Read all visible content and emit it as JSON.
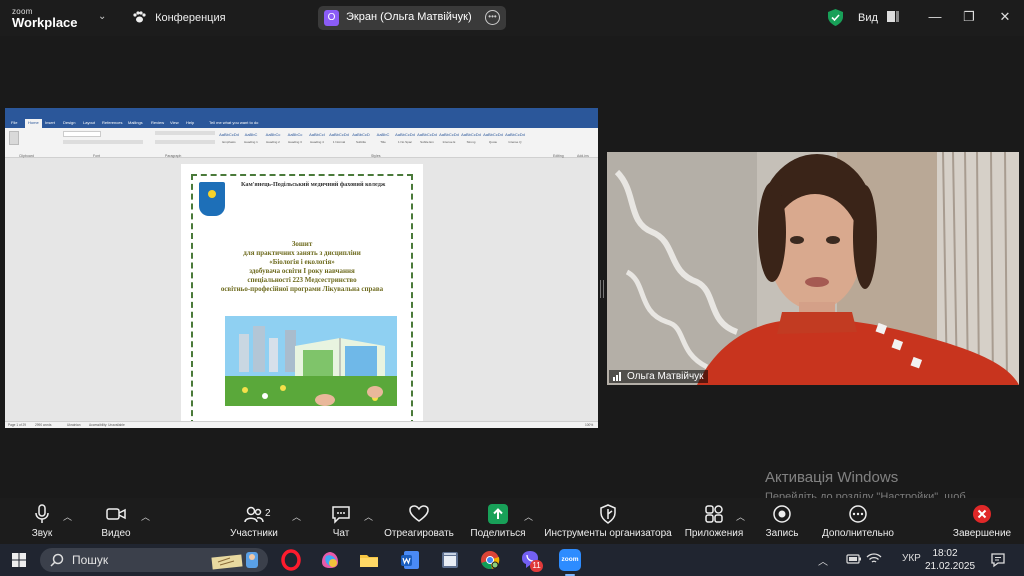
{
  "topbar": {
    "logo_small": "zoom",
    "logo_big": "Workplace",
    "conference_label": "Конференция",
    "share_initial": "О",
    "share_label": "Экран (Ольга Матвійчук)",
    "view_label": "Вид",
    "minimize_glyph": "—",
    "restore_glyph": "❐",
    "close_glyph": "✕"
  },
  "shared_screen": {
    "word_tabs": [
      "File",
      "Home",
      "Insert",
      "Design",
      "Layout",
      "References",
      "Mailings",
      "Review",
      "View",
      "Help",
      "Tell me what you want to do"
    ],
    "ribbon_groups": [
      "Clipboard",
      "Font",
      "Paragraph",
      "Styles",
      "Editing",
      "Add-ins"
    ],
    "styles": [
      {
        "sample": "AaBbCcDd",
        "label": "Emphasis"
      },
      {
        "sample": "AaBbC",
        "label": "Heading 1"
      },
      {
        "sample": "AaBbCc",
        "label": "Heading 2"
      },
      {
        "sample": "AaBbCc",
        "label": "Heading 3"
      },
      {
        "sample": "AaBbCcI",
        "label": "Heading 4"
      },
      {
        "sample": "AaBbCcDd",
        "label": "1 Normal"
      },
      {
        "sample": "AaBbCcD",
        "label": "Subtitle"
      },
      {
        "sample": "AaBbC",
        "label": "Title"
      },
      {
        "sample": "AaBbCcDd",
        "label": "1 No Spac"
      },
      {
        "sample": "AaBbCcDd",
        "label": "Subtle Em"
      },
      {
        "sample": "AaBbCcDd",
        "label": "Intense E"
      },
      {
        "sample": "AaBbCcDd",
        "label": "Strong"
      },
      {
        "sample": "AaBbCcDd",
        "label": "Quote"
      },
      {
        "sample": "AaBbCcDd",
        "label": "Intense Q"
      }
    ],
    "college": "Кам'янець-Подільський медичний фаховий коледж",
    "title_lines": [
      "Зошит",
      "для практичних занять з дисципліни",
      "«Біологія і екологія»",
      "здобувача освіти І року навчання",
      "спеціальності 223 Медсестринство",
      "освітньо-професійної програми Лікувальна справа"
    ],
    "status": {
      "page": "Page 1 of 29",
      "words": "2990 words",
      "language": "Ukrainian",
      "accessibility": "Accessibility: Unavailable",
      "zoom": "100%"
    }
  },
  "video": {
    "participant_name": "Ольга Матвійчук"
  },
  "activation": {
    "title": "Активація Windows",
    "text": "Перейдіть до розділу \"Настройки\", щоб активувати Windows."
  },
  "toolbar": {
    "audio": "Звук",
    "video": "Видео",
    "participants": "Участники",
    "participants_count": "2",
    "chat": "Чат",
    "reactions": "Отреагировать",
    "share": "Поделиться",
    "host_tools": "Инструменты организатора",
    "apps": "Приложения",
    "record": "Запись",
    "more": "Дополнительно",
    "end": "Завершение"
  },
  "taskbar": {
    "search_placeholder": "Пошук",
    "viber_badge": "11",
    "zoom_app_label": "zoom",
    "language": "УКР",
    "time": "18:02",
    "date": "21.02.2025"
  },
  "colors": {
    "zoom_bg": "#1c1c1c",
    "share_green": "#18a058",
    "end_red": "#e02828",
    "word_blue": "#2b579a",
    "title_olive": "#6e6b1f"
  }
}
